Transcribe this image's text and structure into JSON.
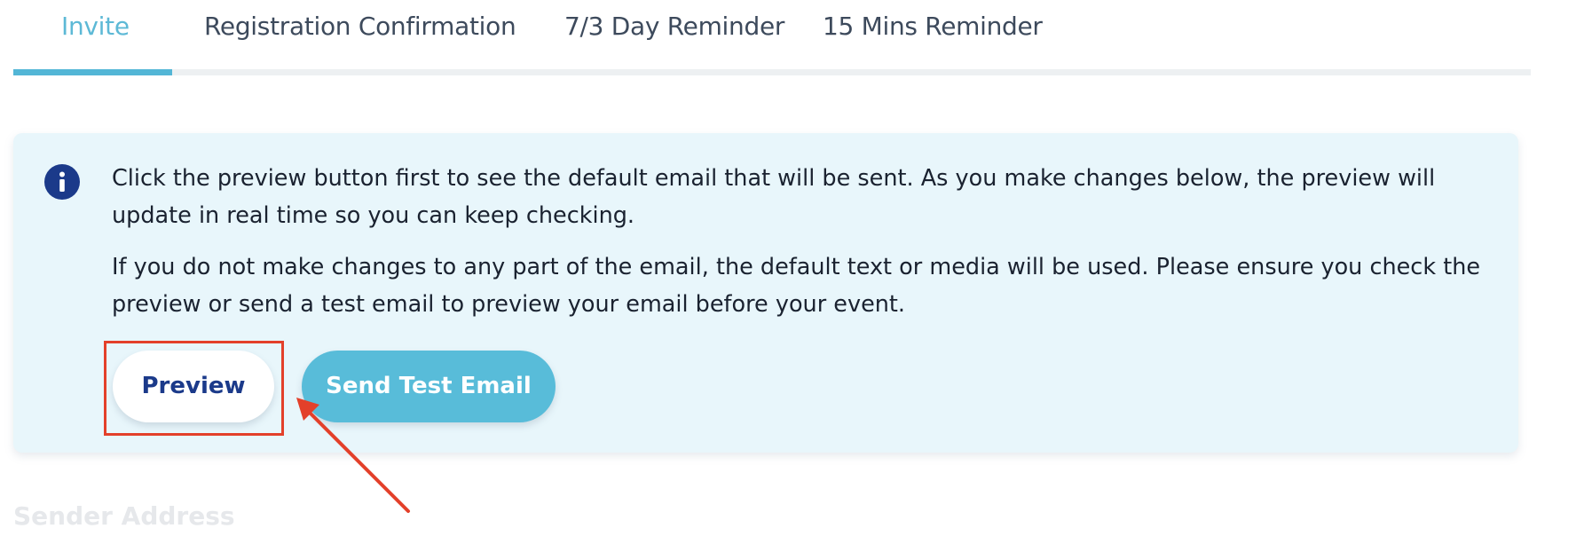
{
  "tabs": [
    {
      "label": "Invite",
      "active": true
    },
    {
      "label": "Registration Confirmation",
      "active": false
    },
    {
      "label": "7/3 Day Reminder",
      "active": false
    },
    {
      "label": "15 Mins Reminder",
      "active": false
    }
  ],
  "info": {
    "icon": "info-icon",
    "paragraph1": "Click the preview button first to see the default email that will be sent. As you make changes below, the preview will update in real time so you can keep checking.",
    "paragraph2": "If you do not make changes to any part of the email, the default text or media will be used. Please ensure you check the preview or send a test email to preview your email before your event."
  },
  "buttons": {
    "preview_label": "Preview",
    "send_test_label": "Send Test Email"
  },
  "form": {
    "sender_address_label": "Sender Address"
  },
  "colors": {
    "accent": "#53b6d6",
    "navy": "#1b3a8a",
    "info_bg": "#e8f6fb",
    "annotation_red": "#e3402a",
    "tab_text": "#3d4a5c"
  }
}
